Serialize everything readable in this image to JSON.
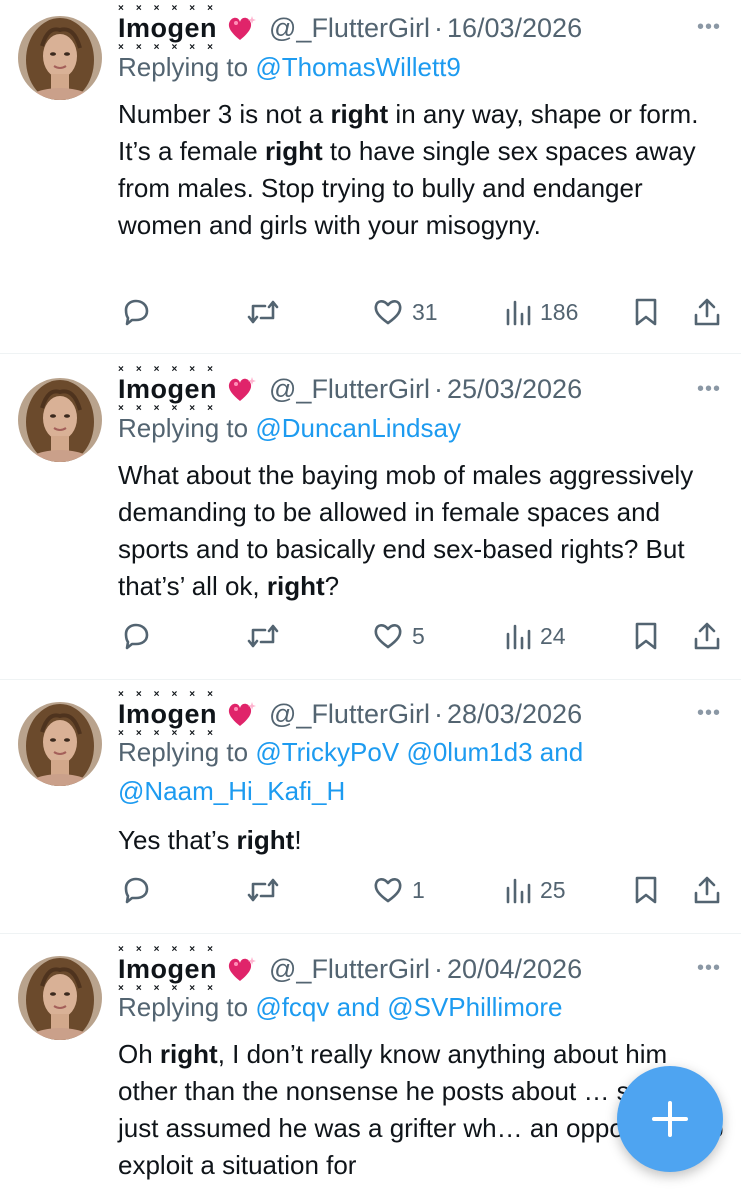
{
  "tweets": [
    {
      "name": "Imogen",
      "handle": "@_FlutterGirl",
      "date": "16/03/2026",
      "replying_prefix": "Replying to",
      "replying_to": [
        "@ThomasWillett9"
      ],
      "replying_rest": [],
      "text_segments": [
        {
          "t": "Number 3 is not a ",
          "b": false
        },
        {
          "t": "right",
          "b": true
        },
        {
          "t": " in any way, shape or form. It’s a female ",
          "b": false
        },
        {
          "t": "right",
          "b": true
        },
        {
          "t": " to have single sex spaces away from males. Stop trying to bully and endanger women and girls with your misogyny.",
          "b": false
        }
      ],
      "likes": "31",
      "views": "186"
    },
    {
      "name": "Imogen",
      "handle": "@_FlutterGirl",
      "date": "25/03/2026",
      "replying_prefix": "Replying to",
      "replying_to": [
        "@DuncanLindsay"
      ],
      "replying_rest": [],
      "text_segments": [
        {
          "t": "What about the baying mob of males aggressively demanding to be allowed in female spaces and sports and to basically end sex-based rights? But that’s’ all ok, ",
          "b": false
        },
        {
          "t": "right",
          "b": true
        },
        {
          "t": "?",
          "b": false
        }
      ],
      "likes": "5",
      "views": "24"
    },
    {
      "name": "Imogen",
      "handle": "@_FlutterGirl",
      "date": "28/03/2026",
      "replying_prefix": "Replying to",
      "replying_to": [
        "@TrickyPoV",
        "@0lum1d3 and",
        "@Naam_Hi_Kafi_H"
      ],
      "replying_rest": [],
      "text_segments": [
        {
          "t": "Yes that’s ",
          "b": false
        },
        {
          "t": "right",
          "b": true
        },
        {
          "t": "!",
          "b": false
        }
      ],
      "likes": "1",
      "views": "25"
    },
    {
      "name": "Imogen",
      "handle": "@_FlutterGirl",
      "date": "20/04/2026",
      "replying_prefix": "Replying to",
      "replying_to": [
        "@fcqv and @SVPhillimore"
      ],
      "replying_rest": [],
      "text_segments": [
        {
          "t": "Oh ",
          "b": false
        },
        {
          "t": "right",
          "b": true
        },
        {
          "t": ", I don’t really know anything about him other than the nonsense he posts about … stuff. I just assumed he was a grifter wh… an opportunity to exploit a situation for",
          "b": false
        }
      ]
    }
  ],
  "name_decoration": {
    "top": "× × × × × ×",
    "bottom": "× × × × × ×"
  },
  "more_label": "•••",
  "separator": "·",
  "colors": {
    "link": "#1d9bf0",
    "muted": "#536471",
    "fab": "#4ea4f1",
    "heart": "#e0246a"
  },
  "icons": [
    "reply-icon",
    "retweet-icon",
    "like-icon",
    "views-icon",
    "bookmark-icon",
    "share-icon",
    "plus-icon",
    "sparkling-heart-icon"
  ]
}
